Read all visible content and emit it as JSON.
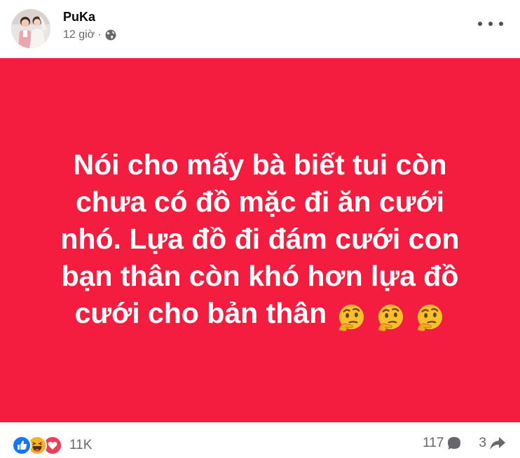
{
  "post": {
    "author": "PuKa",
    "time": "12 giờ",
    "separator": "·",
    "privacy_icon": "globe-icon",
    "more_icon": "more-horizontal-icon",
    "background_color": "#f41c3f",
    "text_color": "#ffffff",
    "text_lines": [
      "Nói cho mấy bà biết tui còn",
      "chưa có đồ mặc đi ăn cưới",
      "nhó. Lựa đồ đi đám cưới con",
      "bạn thân còn khó hơn lựa đồ",
      "cưới cho bản thân"
    ],
    "emojis": [
      "thinking-face-icon",
      "thinking-face-icon",
      "thinking-face-icon"
    ]
  },
  "footer": {
    "reactions": [
      "like-icon",
      "haha-icon",
      "love-icon"
    ],
    "reaction_count": "11K",
    "comment_count": "117",
    "comment_icon": "comment-icon",
    "share_count": "3",
    "share_icon": "share-icon"
  },
  "colors": {
    "like": "#1877f2",
    "love": "#f33e58",
    "haha": "#f7b125",
    "secondary_text": "#65676b"
  }
}
